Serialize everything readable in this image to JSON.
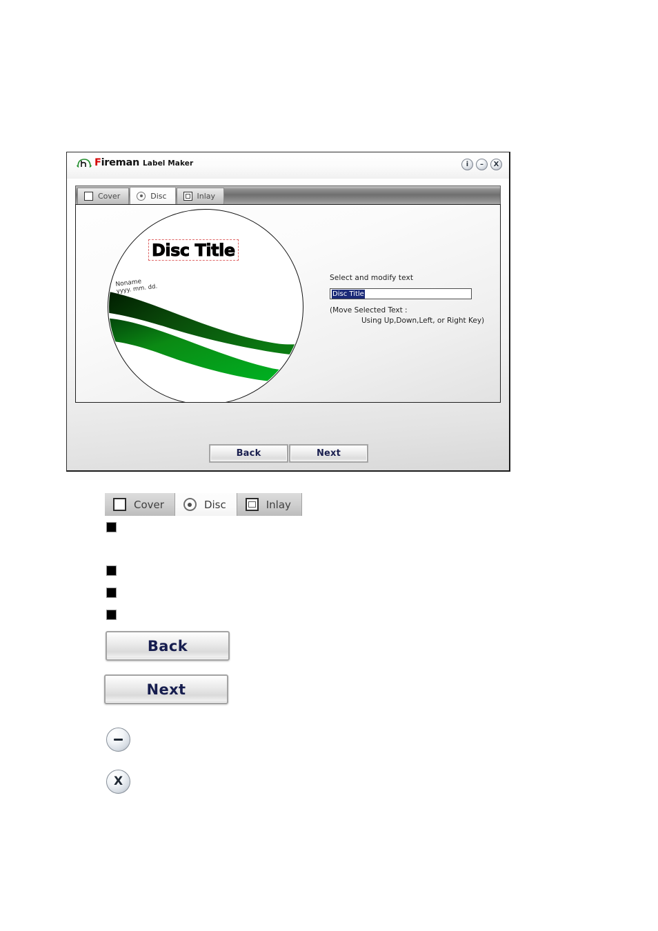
{
  "app": {
    "brand_name_red": "F",
    "brand_name_rest": "ireman",
    "brand_subtitle": "Label Maker",
    "window_buttons": [
      {
        "name": "info-button",
        "glyph": "i"
      },
      {
        "name": "minimize-button",
        "glyph": "–"
      },
      {
        "name": "close-button",
        "glyph": "X"
      }
    ],
    "tabs": [
      {
        "label": "Cover",
        "icon": "cover-square-icon",
        "active": false
      },
      {
        "label": "Disc",
        "icon": "disc-circle-icon",
        "active": true
      },
      {
        "label": "Inlay",
        "icon": "inlay-square-icon",
        "active": false
      }
    ],
    "preview": {
      "disc_title": "Disc Title",
      "disc_name": "Noname",
      "disc_date": "yyyy. mm. dd."
    },
    "side_panel": {
      "instruction": "Select and modify text",
      "input_value": "Disc Title",
      "input_placeholder": "Disc Title",
      "hint_line1": "(Move Selected Text :",
      "hint_line2": "Using Up,Down,Left, or Right Key)"
    },
    "footer": {
      "back_label": "Back",
      "next_label": "Next"
    }
  },
  "doc": {
    "tabs": [
      {
        "label": "Cover",
        "icon": "cover-square-icon",
        "active": false
      },
      {
        "label": "Disc",
        "icon": "disc-circle-icon",
        "active": true
      },
      {
        "label": "Inlay",
        "icon": "inlay-square-icon",
        "active": false
      }
    ],
    "bullets": [
      "",
      "",
      "",
      ""
    ],
    "back_label": "Back",
    "next_label": "Next",
    "minimize_glyph": "–",
    "close_glyph": "X"
  },
  "colors": {
    "brand_red": "#d40000",
    "brand_green": "#1f8c2a",
    "selection_blue": "#1b2a78",
    "button_text_navy": "#161d4e",
    "wave_dark_green": "#003300",
    "wave_bright_green": "#00a81f",
    "selection_dashed_red": "#e06666"
  }
}
